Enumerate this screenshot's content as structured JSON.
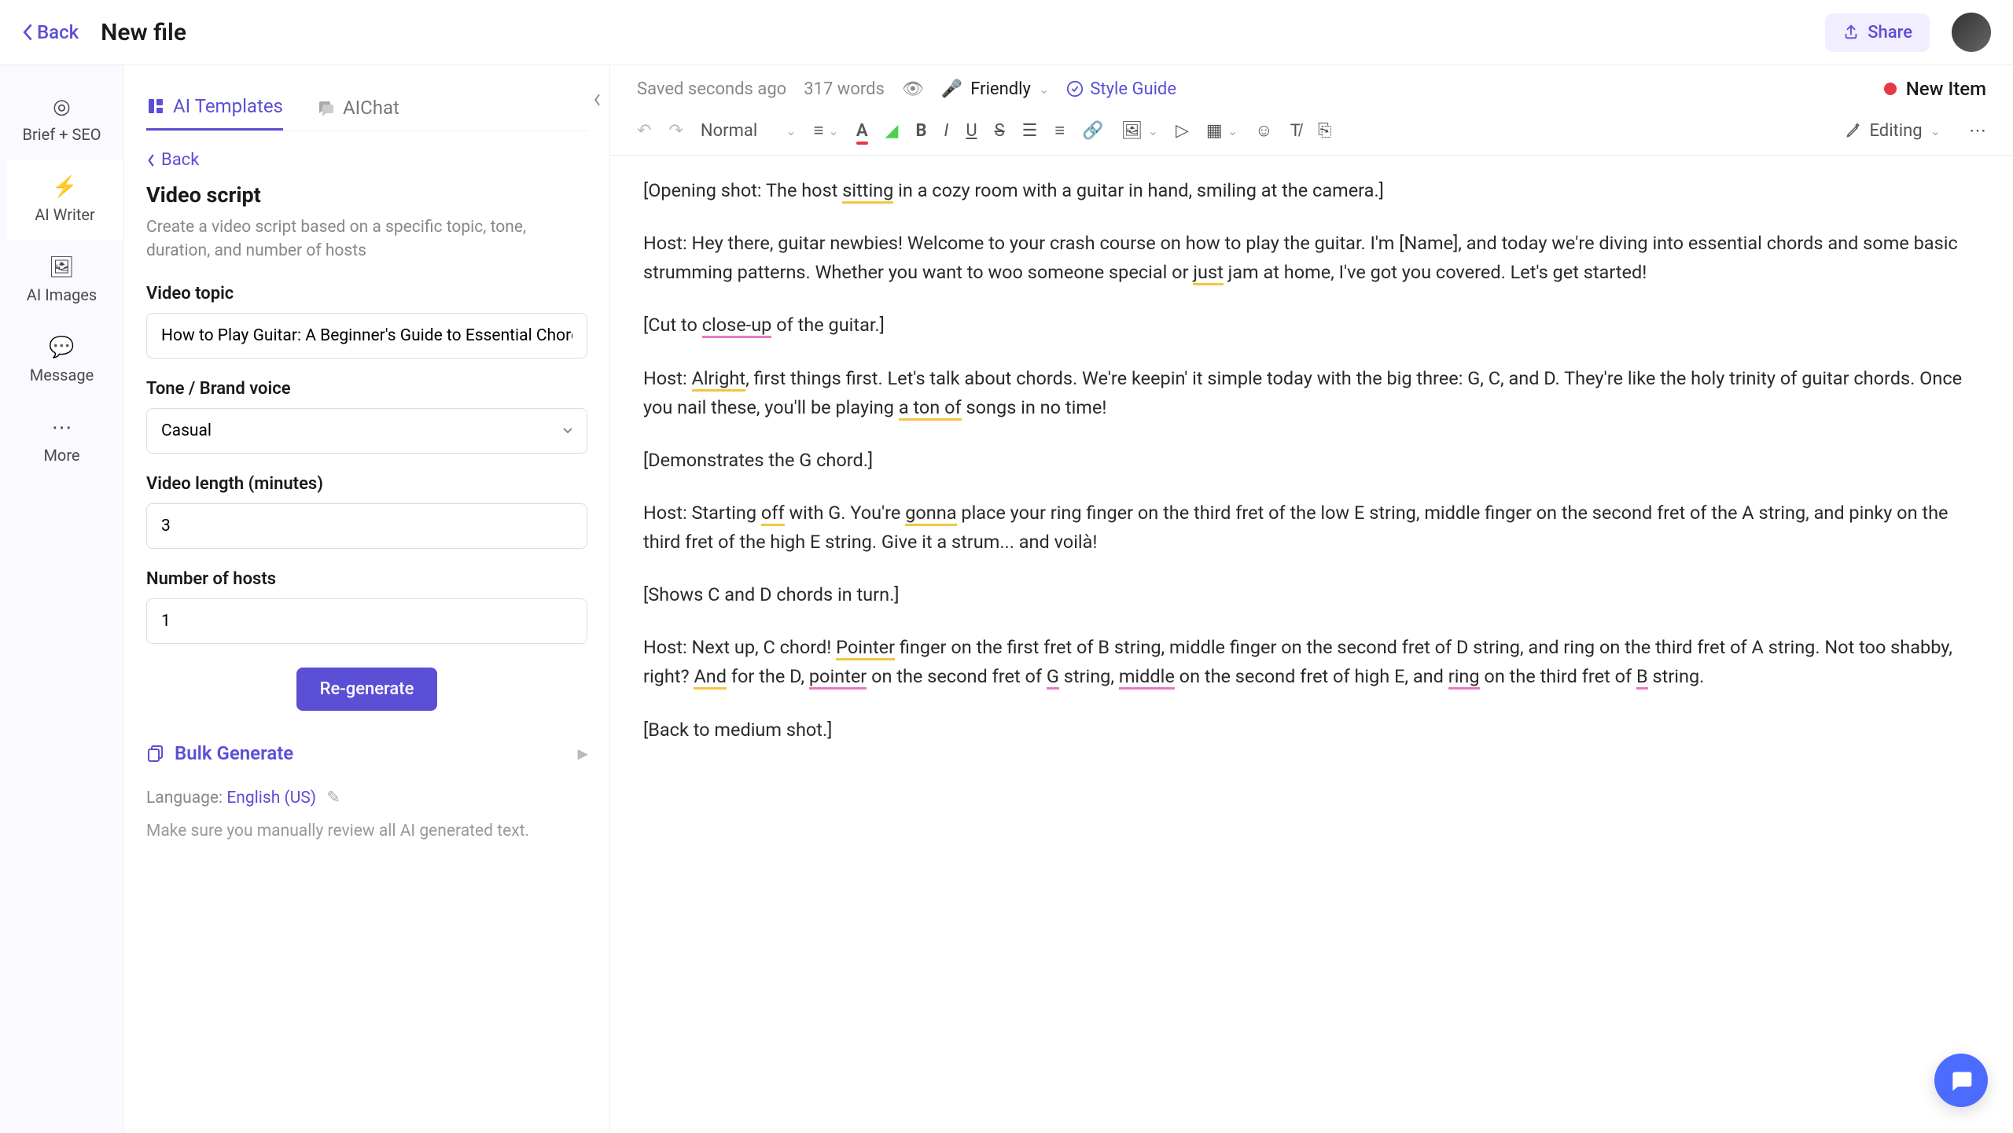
{
  "topbar": {
    "back": "Back",
    "title": "New file",
    "share": "Share"
  },
  "rail": {
    "items": [
      {
        "label": "Brief + SEO"
      },
      {
        "label": "AI Writer"
      },
      {
        "label": "AI Images"
      },
      {
        "label": "Message"
      },
      {
        "label": "More"
      }
    ]
  },
  "panel": {
    "tabs": [
      {
        "label": "AI Templates"
      },
      {
        "label": "AIChat"
      }
    ],
    "back": "Back",
    "title": "Video script",
    "desc": "Create a video script based on a specific topic, tone, duration, and number of hosts",
    "topic_label": "Video topic",
    "topic_value": "How to Play Guitar: A Beginner's Guide to Essential Chords and Strumming",
    "tone_label": "Tone / Brand voice",
    "tone_value": "Casual",
    "length_label": "Video length (minutes)",
    "length_value": "3",
    "hosts_label": "Number of hosts",
    "hosts_value": "1",
    "regenerate": "Re-generate",
    "bulk": "Bulk Generate",
    "lang_prefix": "Language: ",
    "lang_value": "English (US)",
    "disclaimer": "Make sure you manually review all AI generated text."
  },
  "editor_top": {
    "saved": "Saved seconds ago",
    "words": "317 words",
    "tone": "Friendly",
    "style_guide": "Style Guide",
    "new_item": "New Item"
  },
  "toolbar": {
    "style": "Normal",
    "mode": "Editing"
  },
  "doc": {
    "p1_a": "[Opening shot: The host ",
    "p1_h1": "sitting",
    "p1_b": " in a cozy room with a guitar in hand, smiling at the camera.]",
    "p2_a": "Host: Hey there, guitar newbies! Welcome to your crash course on how to play the guitar. I'm [Name], and today we're diving into essential chords and some basic strumming patterns. Whether you want to woo someone special or ",
    "p2_h1": "just",
    "p2_b": " jam at home, I've got you covered. Let's get started!",
    "p3_a": "[Cut to ",
    "p3_h1": "close-up",
    "p3_b": " of the guitar.]",
    "p4_a": "Host: ",
    "p4_h1": "Alright",
    "p4_b": ", first things first. Let's talk about chords. We're keepin' it simple today with the big three: G, C, and D. They're like the holy trinity of guitar chords. Once you nail these, you'll be playing ",
    "p4_h2": "a ton of",
    "p4_c": " songs in no time!",
    "p5": "[Demonstrates the G chord.]",
    "p6_a": "Host: Starting ",
    "p6_h1": "off",
    "p6_b": " with G. You're ",
    "p6_h2": "gonna",
    "p6_c": " place your ring finger on the third fret of the low E string, middle finger on the second fret of the A string, and pinky on the third fret of the high E string. Give it a strum... and voilà!",
    "p7": "[Shows C and D chords in turn.]",
    "p8_a": "Host: Next up, C chord! ",
    "p8_h1": "Pointer",
    "p8_b": " finger on the first fret of B string, middle finger on the second fret of D string, and ring on the third fret of A string. Not too shabby, right? ",
    "p8_h2": "And",
    "p8_c": " for the D, ",
    "p8_h3": "pointer",
    "p8_d": " on the second fret of ",
    "p8_h4": "G",
    "p8_e": " string, ",
    "p8_h5": "middle",
    "p8_f": " on the second fret of high E, and ",
    "p8_h6": "ring",
    "p8_g": " on the third fret of ",
    "p8_h7": "B",
    "p8_h": " string.",
    "p9": "[Back to medium shot.]"
  }
}
